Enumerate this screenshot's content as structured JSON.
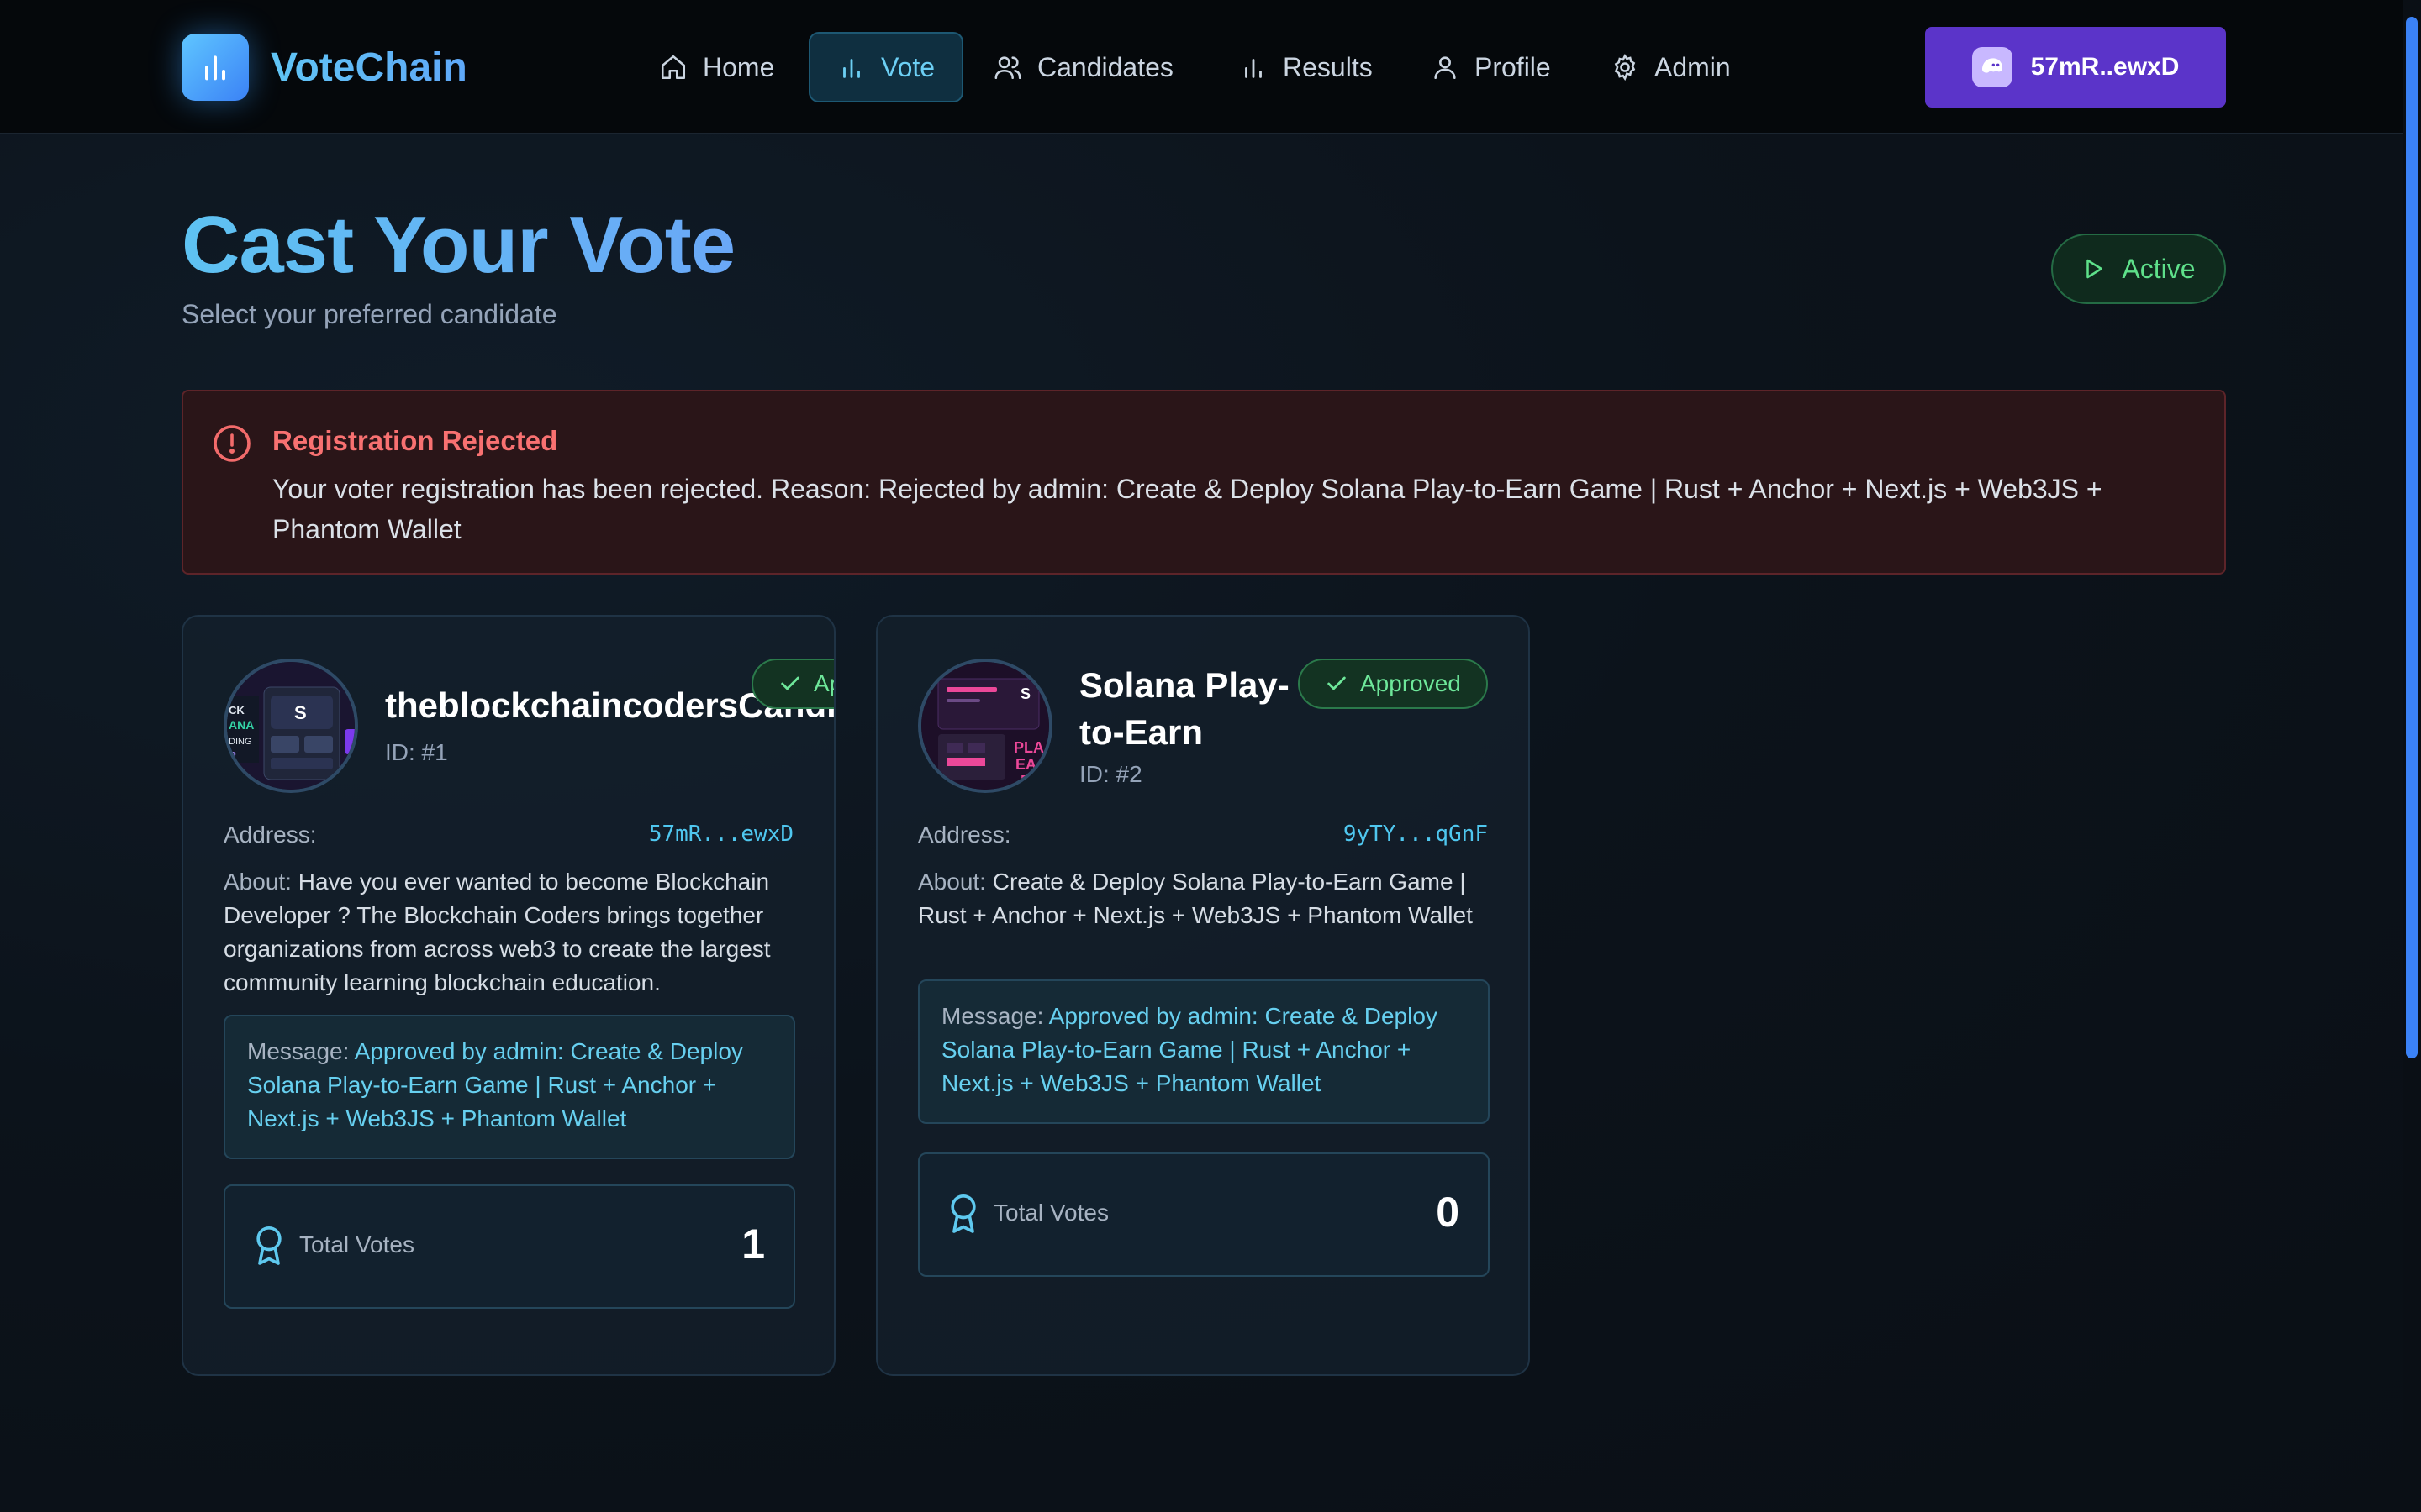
{
  "app": {
    "name": "VoteChain"
  },
  "nav": {
    "items": [
      {
        "label": "Home",
        "icon": "home-icon",
        "active": false
      },
      {
        "label": "Vote",
        "icon": "bar-chart-icon",
        "active": true
      },
      {
        "label": "Candidates",
        "icon": "users-icon",
        "active": false
      },
      {
        "label": "Results",
        "icon": "bar-chart-icon",
        "active": false
      },
      {
        "label": "Profile",
        "icon": "user-icon",
        "active": false
      },
      {
        "label": "Admin",
        "icon": "gear-icon",
        "active": false
      }
    ],
    "wallet": {
      "label": "57mR..ewxD",
      "icon": "phantom-ghost-icon",
      "color": "#5b34c9"
    }
  },
  "header": {
    "title": "Cast Your Vote",
    "subtitle": "Select your preferred candidate",
    "status": "Active"
  },
  "alert": {
    "title": "Registration Rejected",
    "message": "Your voter registration has been rejected. Reason: Rejected by admin: Create & Deploy Solana Play-to-Earn Game | Rust + Anchor + Next.js + Web3JS + Phantom Wallet"
  },
  "labels": {
    "address": "Address:",
    "about": "About:",
    "message": "Message:",
    "total_votes": "Total Votes"
  },
  "candidates": [
    {
      "name": "theblockchaincodersCandidate",
      "id": "ID: #1",
      "status": "Approved",
      "address": "57mR...ewxD",
      "about": "Have you ever wanted to become Blockchain Developer ? The Blockchain Coders brings together organizations from across web3 to create the largest community learning blockchain education.",
      "message": "Approved by admin: Create & Deploy Solana Play-to-Earn Game | Rust + Anchor + Next.js + Web3JS + Phantom Wallet",
      "votes": "1"
    },
    {
      "name": "Solana Play-to-Earn",
      "id": "ID: #2",
      "status": "Approved",
      "address": "9yTY...qGnF",
      "about": "Create & Deploy Solana Play-to-Earn Game | Rust + Anchor + Next.js + Web3JS + Phantom Wallet",
      "message": "Approved by admin: Create & Deploy Solana Play-to-Earn Game | Rust + Anchor + Next.js + Web3JS + Phantom Wallet",
      "votes": "0"
    }
  ],
  "colors": {
    "accent": "#60c5f5",
    "success": "#5ee08a",
    "danger": "#f87171",
    "wallet": "#5b34c9"
  }
}
